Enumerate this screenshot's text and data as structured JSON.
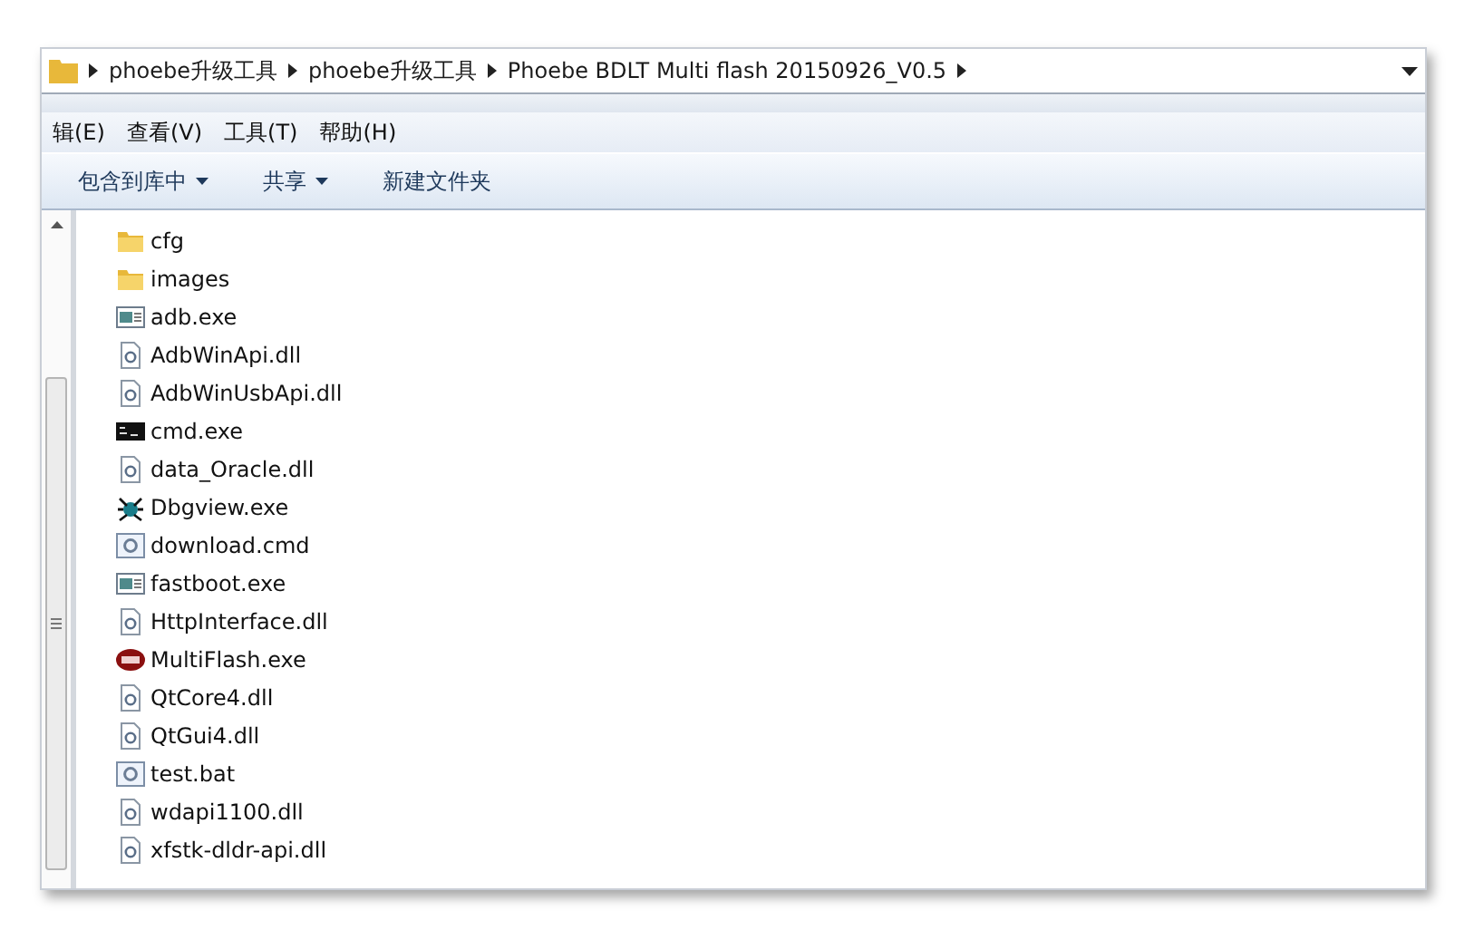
{
  "address_bar": {
    "crumbs": [
      "phoebe升级工具",
      "phoebe升级工具",
      "Phoebe BDLT Multi flash 20150926_V0.5"
    ]
  },
  "menu_bar": [
    "辑(E)",
    "查看(V)",
    "工具(T)",
    "帮助(H)"
  ],
  "toolbar": [
    {
      "label": "包含到库中",
      "dropdown": true
    },
    {
      "label": "共享",
      "dropdown": true
    },
    {
      "label": "新建文件夹",
      "dropdown": false
    }
  ],
  "files": [
    {
      "name": "cfg",
      "kind": "folder"
    },
    {
      "name": "images",
      "kind": "folder"
    },
    {
      "name": "adb.exe",
      "kind": "app"
    },
    {
      "name": "AdbWinApi.dll",
      "kind": "dll"
    },
    {
      "name": "AdbWinUsbApi.dll",
      "kind": "dll"
    },
    {
      "name": "cmd.exe",
      "kind": "console"
    },
    {
      "name": "data_Oracle.dll",
      "kind": "dll"
    },
    {
      "name": "Dbgview.exe",
      "kind": "debugger"
    },
    {
      "name": "download.cmd",
      "kind": "script"
    },
    {
      "name": "fastboot.exe",
      "kind": "app"
    },
    {
      "name": "HttpInterface.dll",
      "kind": "dll"
    },
    {
      "name": "MultiFlash.exe",
      "kind": "flash"
    },
    {
      "name": "QtCore4.dll",
      "kind": "dll"
    },
    {
      "name": "QtGui4.dll",
      "kind": "dll"
    },
    {
      "name": "test.bat",
      "kind": "script"
    },
    {
      "name": "wdapi1100.dll",
      "kind": "dll"
    },
    {
      "name": "xfstk-dldr-api.dll",
      "kind": "dll"
    }
  ]
}
